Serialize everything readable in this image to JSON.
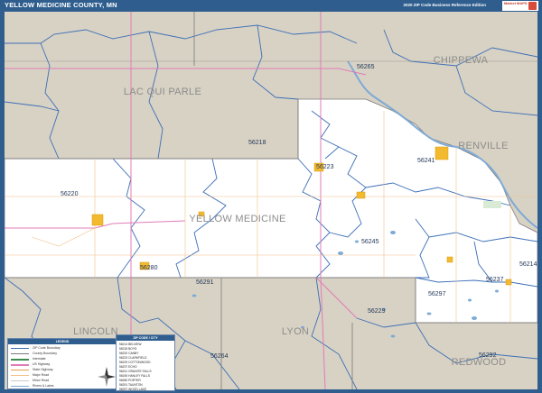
{
  "header": {
    "title": "YELLOW MEDICINE COUNTY, MN",
    "subtitle": "2020 ZIP Code Business Reference Edition",
    "logo_text": "Market MAPS"
  },
  "colors": {
    "frame": "#2f5e8e",
    "outside_land": "#d8d2c4",
    "county_fill": "#ffffff",
    "zip_boundary": "#3d6fb6",
    "water": "#7eaad6",
    "highway": "#e07cb8",
    "road": "#f2c08a",
    "city": "#f3b92f"
  },
  "regions": {
    "lac_qui_parle": "LAC QUI PARLE",
    "chippewa": "CHIPPEWA",
    "renville": "RENVILLE",
    "yellow_medicine": "YELLOW MEDICINE",
    "lincoln": "LINCOLN",
    "lyon": "LYON",
    "redwood": "REDWOOD"
  },
  "zips": {
    "z56265": "56265",
    "z56218": "56218",
    "z56223": "56223",
    "z56241": "56241",
    "z56220": "56220",
    "z56245": "56245",
    "z56280": "56280",
    "z56291": "56291",
    "z56297": "56297",
    "z56237": "56237",
    "z56214": "56214",
    "z56229": "56229",
    "z56292": "56292",
    "z56264": "56264"
  },
  "legend": {
    "title": "LEGEND",
    "rows": [
      "ZIP Code Boundary",
      "County Boundary",
      "Interstate",
      "US Highway",
      "State Highway",
      "Major Road",
      "Minor Road",
      "Rivers & Lakes"
    ]
  },
  "zip_legend": {
    "title": "ZIP CODE / CITY",
    "rows": [
      "56214 BELVIEW",
      "56218 BOYD",
      "56220 CANBY",
      "56223 CLARKFIELD",
      "56229 COTTONWOOD",
      "56237 ECHO",
      "56241 GRANITE FALLS",
      "56245 HANLEY FALLS",
      "56280 PORTER",
      "56291 TAUNTON",
      "56297 WOOD LAKE"
    ]
  }
}
